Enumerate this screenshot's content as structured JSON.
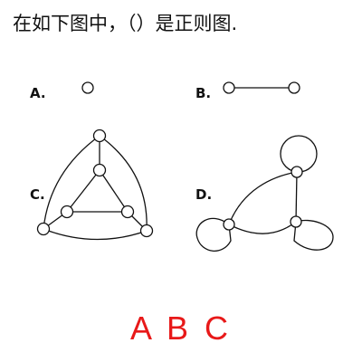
{
  "question": {
    "text": "在如下图中，（）是正则图."
  },
  "figure": {
    "options": [
      {
        "label": "A."
      },
      {
        "label": "B."
      },
      {
        "label": "C."
      },
      {
        "label": "D."
      }
    ]
  },
  "answer": {
    "text": "A B C",
    "color": "#e81919"
  }
}
